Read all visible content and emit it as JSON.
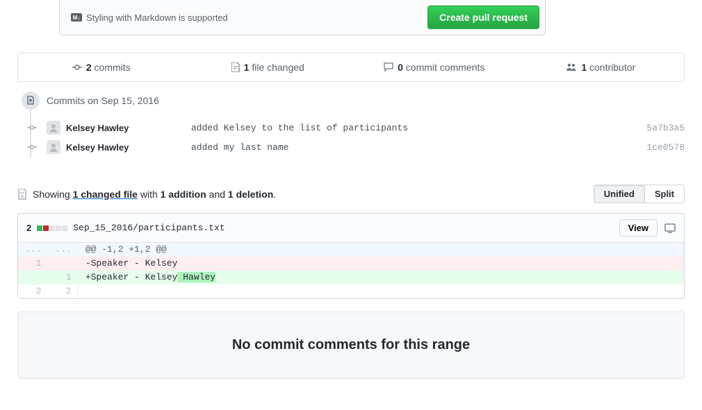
{
  "footer": {
    "md_note": "Styling with Markdown is supported",
    "md_icon": "M↓",
    "create_btn": "Create pull request"
  },
  "tabs": {
    "commits_count": "2",
    "commits_label": " commits",
    "files_count": "1",
    "files_label": " file changed",
    "comments_count": "0",
    "comments_label": " commit comments",
    "contrib_count": "1",
    "contrib_label": " contributor"
  },
  "timeline": {
    "header": "Commits on Sep 15, 2016",
    "commits": [
      {
        "author": "Kelsey Hawley",
        "msg": "added Kelsey to the list of participants",
        "sha": "5a7b3a5"
      },
      {
        "author": "Kelsey Hawley",
        "msg": "added my last name",
        "sha": "1ce0578"
      }
    ]
  },
  "summary": {
    "prefix": "Showing ",
    "link": "1 changed file",
    "mid1": " with ",
    "additions": "1 addition",
    "mid2": " and ",
    "deletions": "1 deletion",
    "suffix": "."
  },
  "toggle": {
    "unified": "Unified",
    "split": "Split"
  },
  "file": {
    "count": "2",
    "name": "Sep_15_2016/participants.txt",
    "view": "View",
    "hunk_l": "...",
    "hunk_r": "...",
    "hunk_text": "@@ -1,2 +1,2 @@",
    "r1_ln": "1",
    "r1_text": "-Speaker - Kelsey",
    "r2_ln": "1",
    "r2_text_a": "+Speaker - Kelsey",
    "r2_text_b": " Hawley",
    "r3_l": "2",
    "r3_r": "2"
  },
  "empty": "No commit comments for this range"
}
